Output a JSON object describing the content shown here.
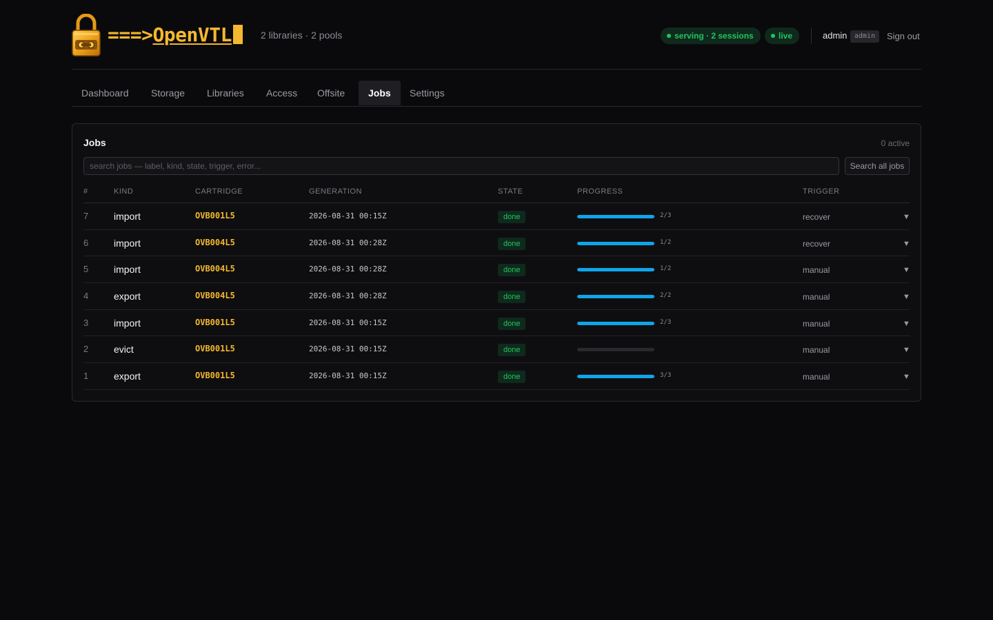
{
  "brand": {
    "arrow": "===>",
    "name": "OpenVTL"
  },
  "header": {
    "meta": "2 libraries · 2 pools",
    "serving": "serving · 2 sessions",
    "live": "live",
    "user": "admin",
    "role": "admin",
    "signout": "Sign out"
  },
  "tabs": [
    "Dashboard",
    "Storage",
    "Libraries",
    "Access",
    "Offsite",
    "Jobs",
    "Settings"
  ],
  "active_tab": "Jobs",
  "panel": {
    "title": "Jobs",
    "count": "0 active",
    "search_placeholder": "search jobs — label, kind, state, trigger, error...",
    "search_button": "Search all jobs"
  },
  "columns": [
    "#",
    "KIND",
    "CARTRIDGE",
    "GENERATION",
    "STATE",
    "PROGRESS",
    "TRIGGER"
  ],
  "jobs": [
    {
      "num": "7",
      "kind": "import",
      "cartridge": "OVB001L5",
      "generation": "2026-08-31 00:15Z",
      "state": "done",
      "progress_label": "2/3",
      "progress": 1.0,
      "trigger": "recover"
    },
    {
      "num": "6",
      "kind": "import",
      "cartridge": "OVB004L5",
      "generation": "2026-08-31 00:28Z",
      "state": "done",
      "progress_label": "1/2",
      "progress": 1.0,
      "trigger": "recover"
    },
    {
      "num": "5",
      "kind": "import",
      "cartridge": "OVB004L5",
      "generation": "2026-08-31 00:28Z",
      "state": "done",
      "progress_label": "1/2",
      "progress": 1.0,
      "trigger": "manual"
    },
    {
      "num": "4",
      "kind": "export",
      "cartridge": "OVB004L5",
      "generation": "2026-08-31 00:28Z",
      "state": "done",
      "progress_label": "2/2",
      "progress": 1.0,
      "trigger": "manual"
    },
    {
      "num": "3",
      "kind": "import",
      "cartridge": "OVB001L5",
      "generation": "2026-08-31 00:15Z",
      "state": "done",
      "progress_label": "2/3",
      "progress": 1.0,
      "trigger": "manual"
    },
    {
      "num": "2",
      "kind": "evict",
      "cartridge": "OVB001L5",
      "generation": "2026-08-31 00:15Z",
      "state": "done",
      "progress_label": "",
      "progress": 0,
      "trigger": "manual"
    },
    {
      "num": "1",
      "kind": "export",
      "cartridge": "OVB001L5",
      "generation": "2026-08-31 00:15Z",
      "state": "done",
      "progress_label": "3/3",
      "progress": 1.0,
      "trigger": "manual"
    }
  ],
  "icons": {
    "logo": "padlock-logo-icon",
    "expand": "caret-down-icon",
    "expand_glyph": "▼"
  },
  "colors": {
    "accent": "#f5b82e",
    "progress": "#0ea5e9",
    "success": "#22c55e",
    "background": "#0a0a0c"
  }
}
